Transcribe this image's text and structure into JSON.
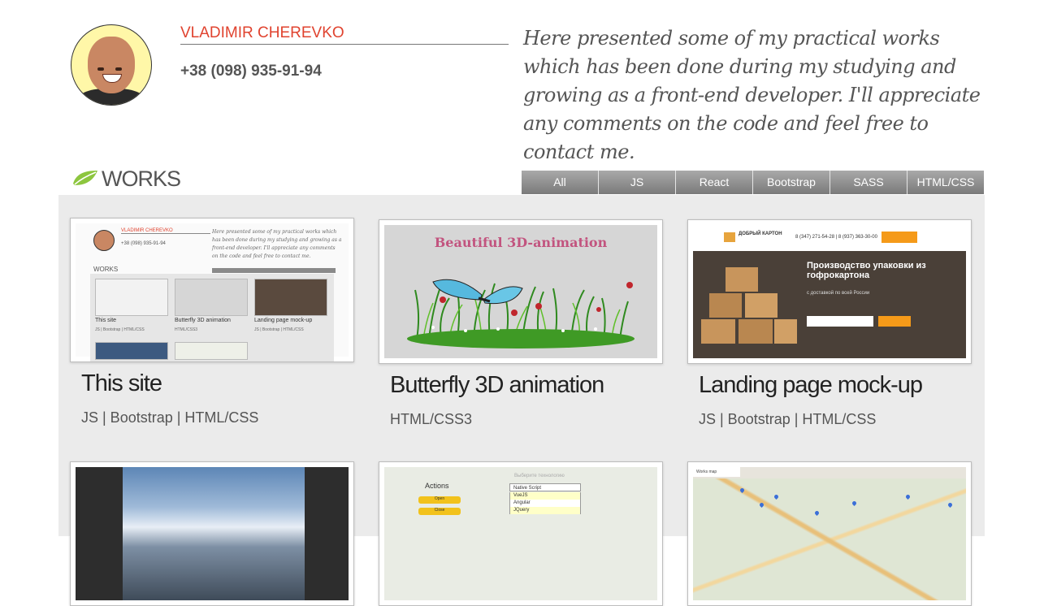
{
  "profile": {
    "name": "VLADIMIR CHEREVKO",
    "phone": "+38 (098) 935-91-94",
    "intro": "Here presented some of my practical works which has been done during my studying and growing as a front-end developer. I'll appreciate any comments on the code and feel free to contact me."
  },
  "works": {
    "title": "WORKS",
    "tabs": [
      "All",
      "JS",
      "React",
      "Bootstrap",
      "SASS",
      "HTML/CSS"
    ]
  },
  "cards": [
    {
      "title": "This site",
      "tags": "JS | Bootstrap | HTML/CSS"
    },
    {
      "title": "Butterfly 3D animation",
      "tags": "HTML/CSS3"
    },
    {
      "title": "Landing page mock-up",
      "tags": "JS | Bootstrap | HTML/CSS"
    }
  ],
  "thumbs": {
    "site": {
      "name": "VLADIMIR CHEREVKO",
      "phone": "+38 (098) 935-91-94",
      "intro": "Here presented some of my practical works which has been done during my studying and growing as a front-end developer. I'll appreciate any comments on the code and feel free to contact me.",
      "works": "WORKS",
      "cards": [
        "This site",
        "Butterfly 3D animation",
        "Landing page mock-up"
      ],
      "tags": [
        "JS | Bootstrap | HTML/CSS",
        "HTML/CSS3",
        "JS | Bootstrap | HTML/CSS"
      ]
    },
    "butterfly": {
      "heading": "Beautiful 3D-animation"
    },
    "landing": {
      "logo": "ДОБРЫЙ КАРТОН",
      "phones": "8 (347) 271-54-28 | 8 (937) 363-30-00",
      "hero": "Производство упаковки из гофрокартона",
      "sub": "с доставкой по всей России"
    },
    "select": {
      "actions": "Actions",
      "caption": "Выберите технологию",
      "selected": "Native Script",
      "options": [
        "VueJS",
        "Angular",
        "JQuery"
      ],
      "buttons": [
        "Open",
        "Close"
      ]
    },
    "map": {
      "tab": "Works map"
    }
  },
  "colors": {
    "name": "#e0432f",
    "tab_top": "#a9a9a9",
    "tab_bottom": "#7a7a7a",
    "panel": "#ebebeb"
  },
  "icons": {
    "works_logo": "leaf-icon"
  }
}
